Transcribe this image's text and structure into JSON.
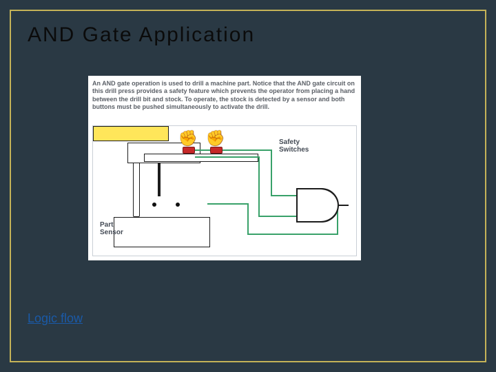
{
  "slide": {
    "title": "AND Gate Application",
    "link_label": "Logic flow"
  },
  "figure": {
    "description": "An AND gate operation is used to drill a machine part. Notice that the AND gate circuit on this drill press provides a safety feature which prevents the operator from placing a hand between the drill bit and stock.  To operate, the stock is detected by a sensor and both buttons must be pushed simultaneously to activate the drill.",
    "labels": {
      "safety_switches": "Safety Switches",
      "part_sensor": "Part Sensor"
    }
  }
}
